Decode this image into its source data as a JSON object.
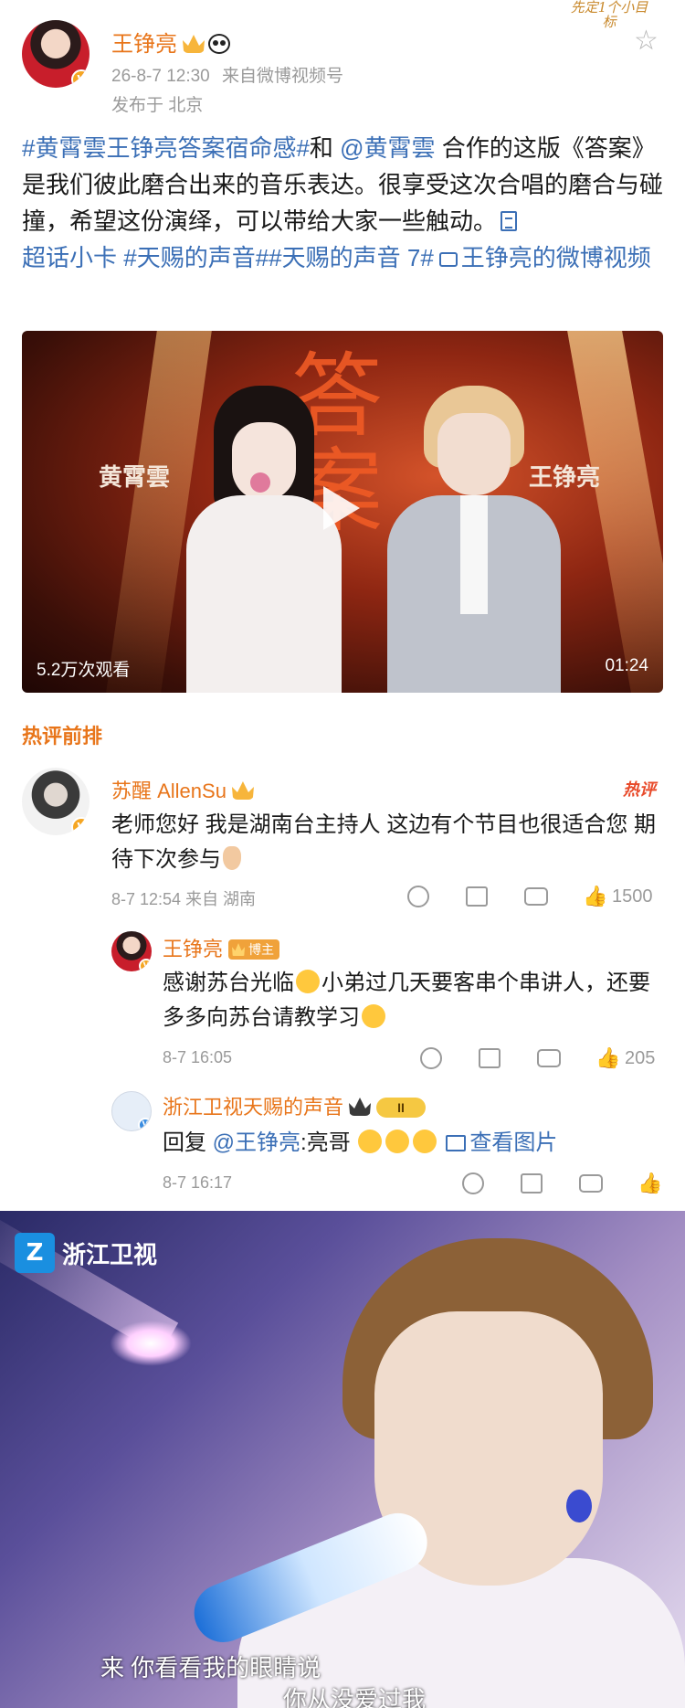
{
  "post": {
    "author": "王铮亮",
    "time": "26-8-7 12:30",
    "source_prefix": "来自",
    "source": "微博视频号",
    "location": "发布于 北京",
    "sticker": "先定1个小目标",
    "text": {
      "tag1": "#黄霄雲王铮亮答案宿命感#",
      "and": "和 ",
      "mention": "@黄霄雲",
      "body": " 合作的这版《答案》是我们彼此磨合出来的音乐表达。很享受这次合唱的磨合与碰撞，希望这份演绎，可以带给大家一些触动。",
      "card": "超话小卡",
      "tag2": " #天赐的声音#",
      "tag3": "#天赐的声音 7#",
      "video_link": "王铮亮的微博视频"
    }
  },
  "video": {
    "title_big": "答案",
    "name_left": "黄霄雲",
    "name_right": "王铮亮",
    "views": "5.2万次观看",
    "duration": "01:24"
  },
  "hot_comments": {
    "title": "热评前排",
    "items": [
      {
        "name": "苏醒 AllenSu",
        "hot_tag": "热评",
        "text": "老师您好 我是湖南台主持人 这边有个节目也很适合您 期待下次参与",
        "meta": "8-7 12:54  来自 湖南",
        "likes": "1500"
      },
      {
        "name": "王铮亮",
        "badge": "博主",
        "text_a": "感谢苏台光临",
        "text_b": "小弟过几天要客串个串讲人，还要多多向苏台请教学习",
        "meta": "8-7 16:05",
        "likes": "205"
      },
      {
        "name": "浙江卫视天赐的声音",
        "level": "II",
        "prefix": "回复 ",
        "mention": "@王铮亮",
        "text": ":亮哥",
        "img_link": "查看图片",
        "meta": "8-7 16:17"
      }
    ]
  },
  "photo": {
    "channel": "浙江卫视",
    "subtitle_1": "来 你看看我的眼睛说",
    "subtitle_2": "你从没爱过我"
  },
  "colors": {
    "username": "#e8751a",
    "link": "#3b6fb6",
    "meta": "#9a9a9a",
    "hot_tag": "#e84a2a"
  }
}
